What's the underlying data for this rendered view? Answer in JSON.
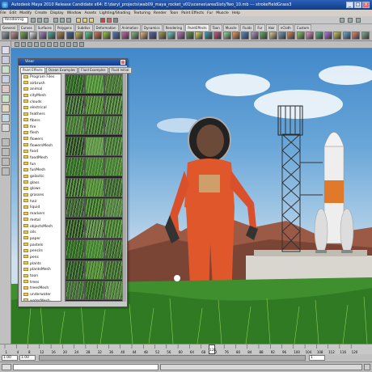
{
  "window": {
    "title": "Autodesk Maya 2010 Release Candidate x64: E:\\daryl_projects\\wab09_maya_rocket_v01\\scenes\\areaSixtyTwo_10.mb  ---  strokeFieldGrass3",
    "minimize": "_",
    "maximize": "□",
    "close": "x"
  },
  "menu": {
    "items": [
      "File",
      "Edit",
      "Modify",
      "Create",
      "Display",
      "Window",
      "Assets",
      "Lighting/Shading",
      "Texturing",
      "Render",
      "Toon",
      "Paint Effects",
      "Fur",
      "Muscle",
      "Help"
    ]
  },
  "statusline": {
    "menuset": "Rendering"
  },
  "shelf": {
    "tabs": [
      "General",
      "Curves",
      "Surfaces",
      "Polygons",
      "Subdivs",
      "Deformation",
      "Animation",
      "Dynamics",
      "Rendering",
      "PaintEffects",
      "Toon",
      "Muscle",
      "Fluids",
      "Fur",
      "Hair",
      "nCloth",
      "Custom"
    ],
    "active_tab": "PaintEffects"
  },
  "visor": {
    "title": "Visor",
    "tabs": [
      "Paint Effects",
      "Ocean Examples",
      "Fluid Examples",
      "Fluid Initial"
    ],
    "active_tab": "Paint Effects",
    "folders": [
      "Program Files",
      "airbrush",
      "animal",
      "cityMesh",
      "clouds",
      "electrical",
      "feathers",
      "fibers",
      "fire",
      "flesh",
      "flowers",
      "flowersMesh",
      "food",
      "foodMesh",
      "fun",
      "funMesh",
      "galactic",
      "glass",
      "glows",
      "grasses",
      "hair",
      "liquid",
      "markers",
      "metal",
      "objectsMesh",
      "oils",
      "paper",
      "pastels",
      "pencils",
      "pens",
      "plants",
      "plantsMesh",
      "toon",
      "trees",
      "treesMesh",
      "underwater",
      "waterMesh",
      "watercolor",
      "weather",
      "wetInk"
    ]
  },
  "timeline": {
    "ticks": [
      "1",
      "4",
      "8",
      "12",
      "16",
      "20",
      "24",
      "28",
      "32",
      "36",
      "40",
      "44",
      "48",
      "52",
      "56",
      "60",
      "64",
      "68",
      "72",
      "76",
      "80",
      "84",
      "88",
      "92",
      "96",
      "100",
      "104",
      "108",
      "112",
      "116",
      "120"
    ],
    "current_frame": "128"
  },
  "range": {
    "start": "1.00",
    "start_inner": "1.00",
    "end": "1"
  },
  "viewport_label": "persp"
}
